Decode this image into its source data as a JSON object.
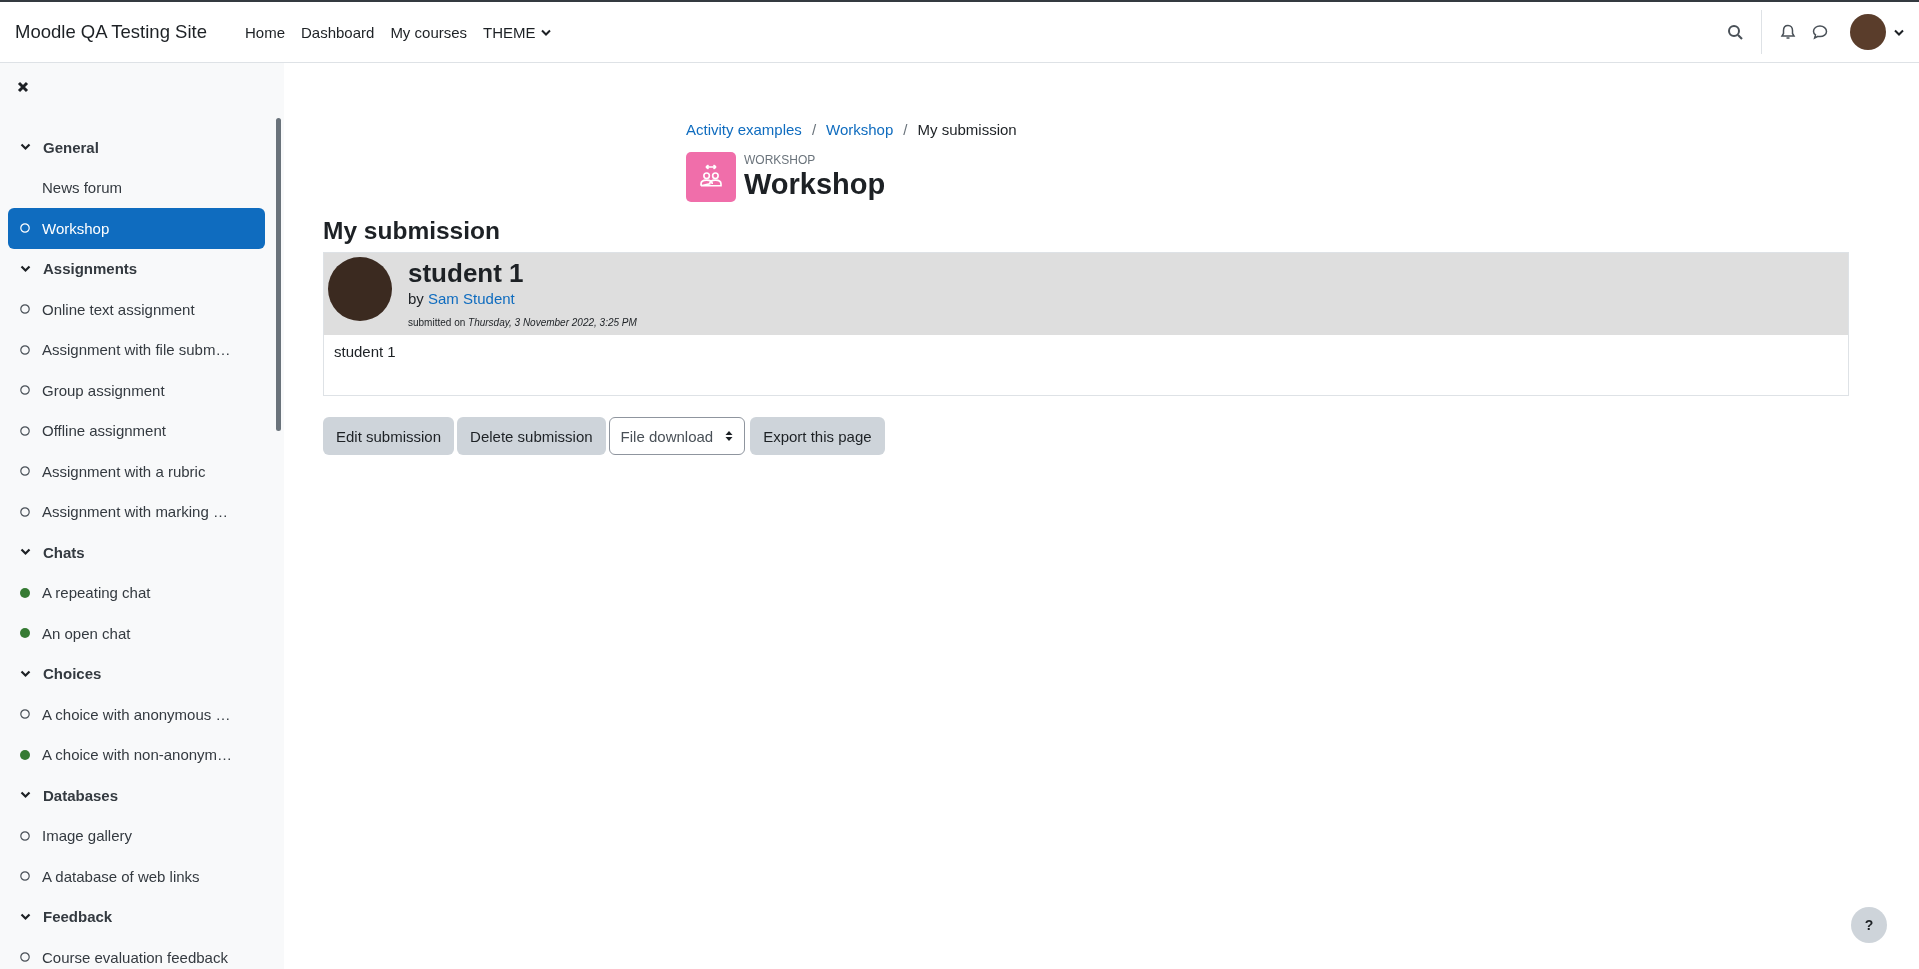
{
  "navbar": {
    "site_name": "Moodle QA Testing Site",
    "links": [
      {
        "label": "Home",
        "dropdown": false
      },
      {
        "label": "Dashboard",
        "dropdown": false
      },
      {
        "label": "My courses",
        "dropdown": false
      },
      {
        "label": "THEME",
        "dropdown": true
      }
    ]
  },
  "course_index": {
    "sections": [
      {
        "title": "General",
        "expanded": true,
        "items": [
          {
            "label": "News forum",
            "tracked": false,
            "selected": false
          },
          {
            "label": "Workshop",
            "tracked": true,
            "completed": false,
            "selected": true
          }
        ]
      },
      {
        "title": "Assignments",
        "expanded": true,
        "items": [
          {
            "label": "Online text assignment",
            "tracked": true,
            "completed": false,
            "selected": false
          },
          {
            "label": "Assignment with file subm…",
            "tracked": true,
            "completed": false,
            "selected": false
          },
          {
            "label": "Group assignment",
            "tracked": true,
            "completed": false,
            "selected": false
          },
          {
            "label": "Offline assignment",
            "tracked": true,
            "completed": false,
            "selected": false
          },
          {
            "label": "Assignment with a rubric",
            "tracked": true,
            "completed": false,
            "selected": false
          },
          {
            "label": "Assignment with marking …",
            "tracked": true,
            "completed": false,
            "selected": false
          }
        ]
      },
      {
        "title": "Chats",
        "expanded": true,
        "items": [
          {
            "label": "A repeating chat",
            "tracked": true,
            "completed": true,
            "selected": false
          },
          {
            "label": "An open chat",
            "tracked": true,
            "completed": true,
            "selected": false
          }
        ]
      },
      {
        "title": "Choices",
        "expanded": true,
        "items": [
          {
            "label": "A choice with anonymous …",
            "tracked": true,
            "completed": false,
            "selected": false
          },
          {
            "label": "A choice with non-anonym…",
            "tracked": true,
            "completed": true,
            "selected": false
          }
        ]
      },
      {
        "title": "Databases",
        "expanded": true,
        "items": [
          {
            "label": "Image gallery",
            "tracked": true,
            "completed": false,
            "selected": false
          },
          {
            "label": "A database of web links",
            "tracked": true,
            "completed": false,
            "selected": false
          }
        ]
      },
      {
        "title": "Feedback",
        "expanded": true,
        "items": [
          {
            "label": "Course evaluation feedback",
            "tracked": true,
            "completed": false,
            "selected": false
          }
        ]
      }
    ]
  },
  "breadcrumb": [
    {
      "label": "Activity examples",
      "link": true
    },
    {
      "separator": "/",
      "label": "Workshop",
      "link": true
    },
    {
      "separator": "/",
      "label": "My submission",
      "link": false
    }
  ],
  "activity": {
    "type_label": "WORKSHOP",
    "title": "Workshop"
  },
  "heading": "My submission",
  "submission": {
    "title": "student 1",
    "by_label": "by",
    "author": "Sam Student",
    "submitted_label": "submitted on",
    "submitted_date": "Thursday, 3 November 2022, 3:25 PM",
    "content": "student 1"
  },
  "actions": [
    {
      "kind": "button",
      "label": "Edit submission"
    },
    {
      "kind": "button",
      "label": "Delete submission"
    },
    {
      "kind": "select",
      "label": "File download"
    },
    {
      "kind": "button",
      "label": "Export this page"
    }
  ],
  "help": {
    "label": "?"
  }
}
